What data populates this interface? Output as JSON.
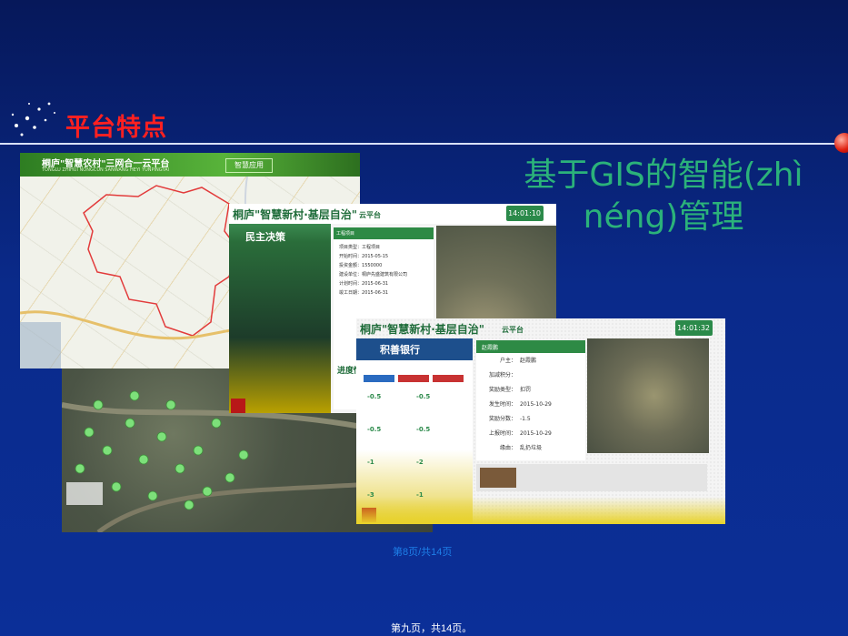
{
  "slide": {
    "title": "平台特点",
    "heading_line1": "基于GIS的智能(zhì",
    "heading_line2": "néng)管理",
    "page_link": "第8页/共14页",
    "footer": "第九页，共14页。"
  },
  "window_map": {
    "brand": "桐庐\"智慧农村\"三网合一云平台",
    "subtitle": "TONGLU ZHIHUI NONGCUN SANWANG HEYI YUNPINGTAI",
    "menu_tab": "智慧应用"
  },
  "window_democracy": {
    "brand": "桐庐\"智慧新村·基层自治\"",
    "cloud": "云平台",
    "clock": "14:01:10",
    "panel_title": "民主决策",
    "detail_header": "工程项目",
    "fields": [
      {
        "label": "项目类型：",
        "value": "工程项目"
      },
      {
        "label": "开始时间：",
        "value": "2015-05-15"
      },
      {
        "label": "投资金额：",
        "value": "1550000"
      },
      {
        "label": "建设单位：",
        "value": "桐庐先盛建筑有限公司"
      },
      {
        "label": "计划时间：",
        "value": "2015-06-31"
      },
      {
        "label": "竣工日期：",
        "value": "2015-06-31"
      }
    ],
    "progress_label": "进度情"
  },
  "window_bank": {
    "brand": "桐庐\"智慧新村·基层自治\"",
    "cloud": "云平台",
    "clock": "14:01:32",
    "panel_title": "积善银行",
    "cells": [
      {
        "value": "-0.5"
      },
      {
        "value": "-0.5"
      },
      {
        "value": "-0.5"
      },
      {
        "value": "-0.5"
      },
      {
        "value": "-1"
      },
      {
        "value": "-2"
      },
      {
        "value": "-3"
      },
      {
        "value": "-1"
      }
    ],
    "detail_header": "赵霞鹏",
    "fields": [
      {
        "label": "户主：",
        "value": "赵霞鹏"
      },
      {
        "label": "加减积分：",
        "value": ""
      },
      {
        "label": "奖励类型：",
        "value": "扣罚"
      },
      {
        "label": "发生时间：",
        "value": "2015-10-29"
      },
      {
        "label": "奖励分数：",
        "value": "-1.5"
      },
      {
        "label": "上报时间：",
        "value": "2015-10-29"
      },
      {
        "label": "缘由：",
        "value": "乱扔垃圾"
      }
    ]
  }
}
